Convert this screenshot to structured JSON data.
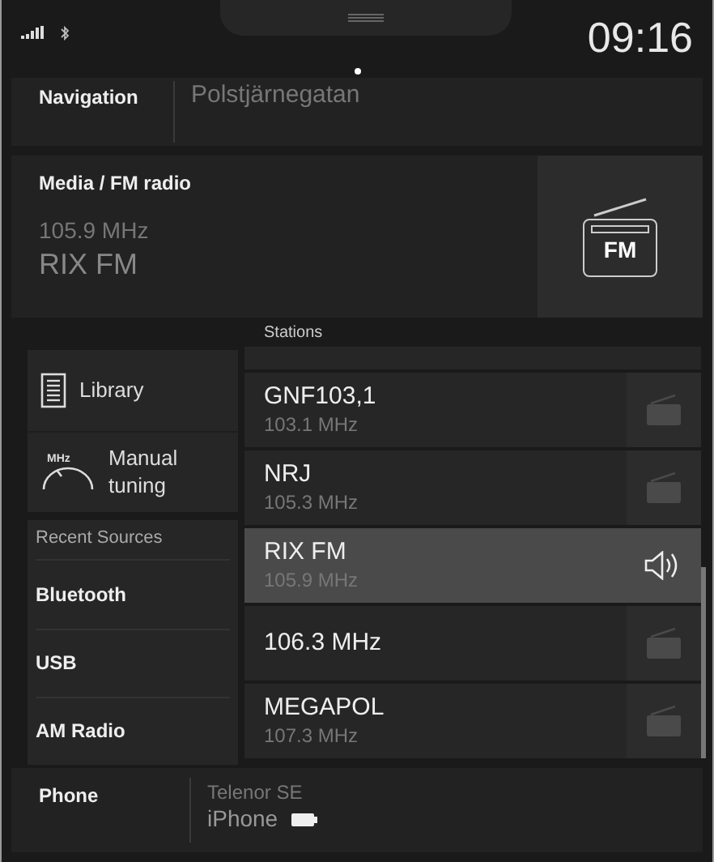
{
  "status_bar": {
    "time": "09:16"
  },
  "navigation": {
    "title": "Navigation",
    "destination": "Polstjärnegatan"
  },
  "media": {
    "title": "Media / FM radio",
    "frequency": "105.9 MHz",
    "station": "RIX FM",
    "badge": "FM"
  },
  "menu": [
    {
      "kind": "library",
      "label": "Library"
    },
    {
      "kind": "tuning",
      "label": "Manual tuning",
      "icon_label": "MHz"
    }
  ],
  "recent_sources": {
    "title": "Recent Sources",
    "items": [
      "Bluetooth",
      "USB",
      "AM Radio"
    ]
  },
  "stations": {
    "title": "Stations",
    "items": [
      {
        "name": "GNF103,1",
        "frequency": "103.1 MHz",
        "selected": false
      },
      {
        "name": "NRJ",
        "frequency": "105.3 MHz",
        "selected": false
      },
      {
        "name": "RIX FM",
        "frequency": "105.9 MHz",
        "selected": true
      },
      {
        "name": "106.3 MHz",
        "selected": false
      },
      {
        "name": "MEGAPOL",
        "frequency": "107.3 MHz",
        "selected": false
      }
    ]
  },
  "phone": {
    "title": "Phone",
    "operator": "Telenor SE",
    "device": "iPhone"
  }
}
